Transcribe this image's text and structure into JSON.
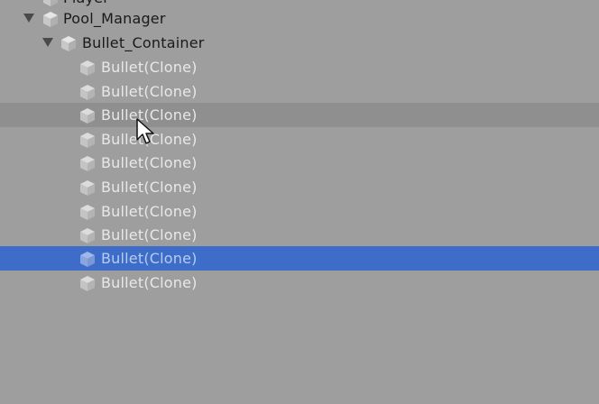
{
  "hierarchy": {
    "partial_top_item": {
      "label": "Player"
    },
    "root": {
      "label": "Pool_Manager",
      "expanded": true
    },
    "container": {
      "label": "Bullet_Container",
      "expanded": true
    },
    "children": [
      {
        "label": "Bullet(Clone)",
        "state": "normal"
      },
      {
        "label": "Bullet(Clone)",
        "state": "normal"
      },
      {
        "label": "Bullet(Clone)",
        "state": "hovered"
      },
      {
        "label": "Bullet(Clone)",
        "state": "normal"
      },
      {
        "label": "Bullet(Clone)",
        "state": "normal"
      },
      {
        "label": "Bullet(Clone)",
        "state": "normal"
      },
      {
        "label": "Bullet(Clone)",
        "state": "normal"
      },
      {
        "label": "Bullet(Clone)",
        "state": "normal"
      },
      {
        "label": "Bullet(Clone)",
        "state": "selected"
      },
      {
        "label": "Bullet(Clone)",
        "state": "normal"
      }
    ]
  },
  "colors": {
    "panel_background": "#9e9e9e",
    "hover_row": "#8f8f8f",
    "selected_row": "#3d6cc9",
    "active_text": "#1a1a1a",
    "inactive_text": "#e8e8e8",
    "selected_text": "#b9ccf0"
  },
  "icons": {
    "foldout": "triangle-down-icon",
    "gameobject": "cube-icon",
    "cursor": "mouse-pointer-icon"
  }
}
